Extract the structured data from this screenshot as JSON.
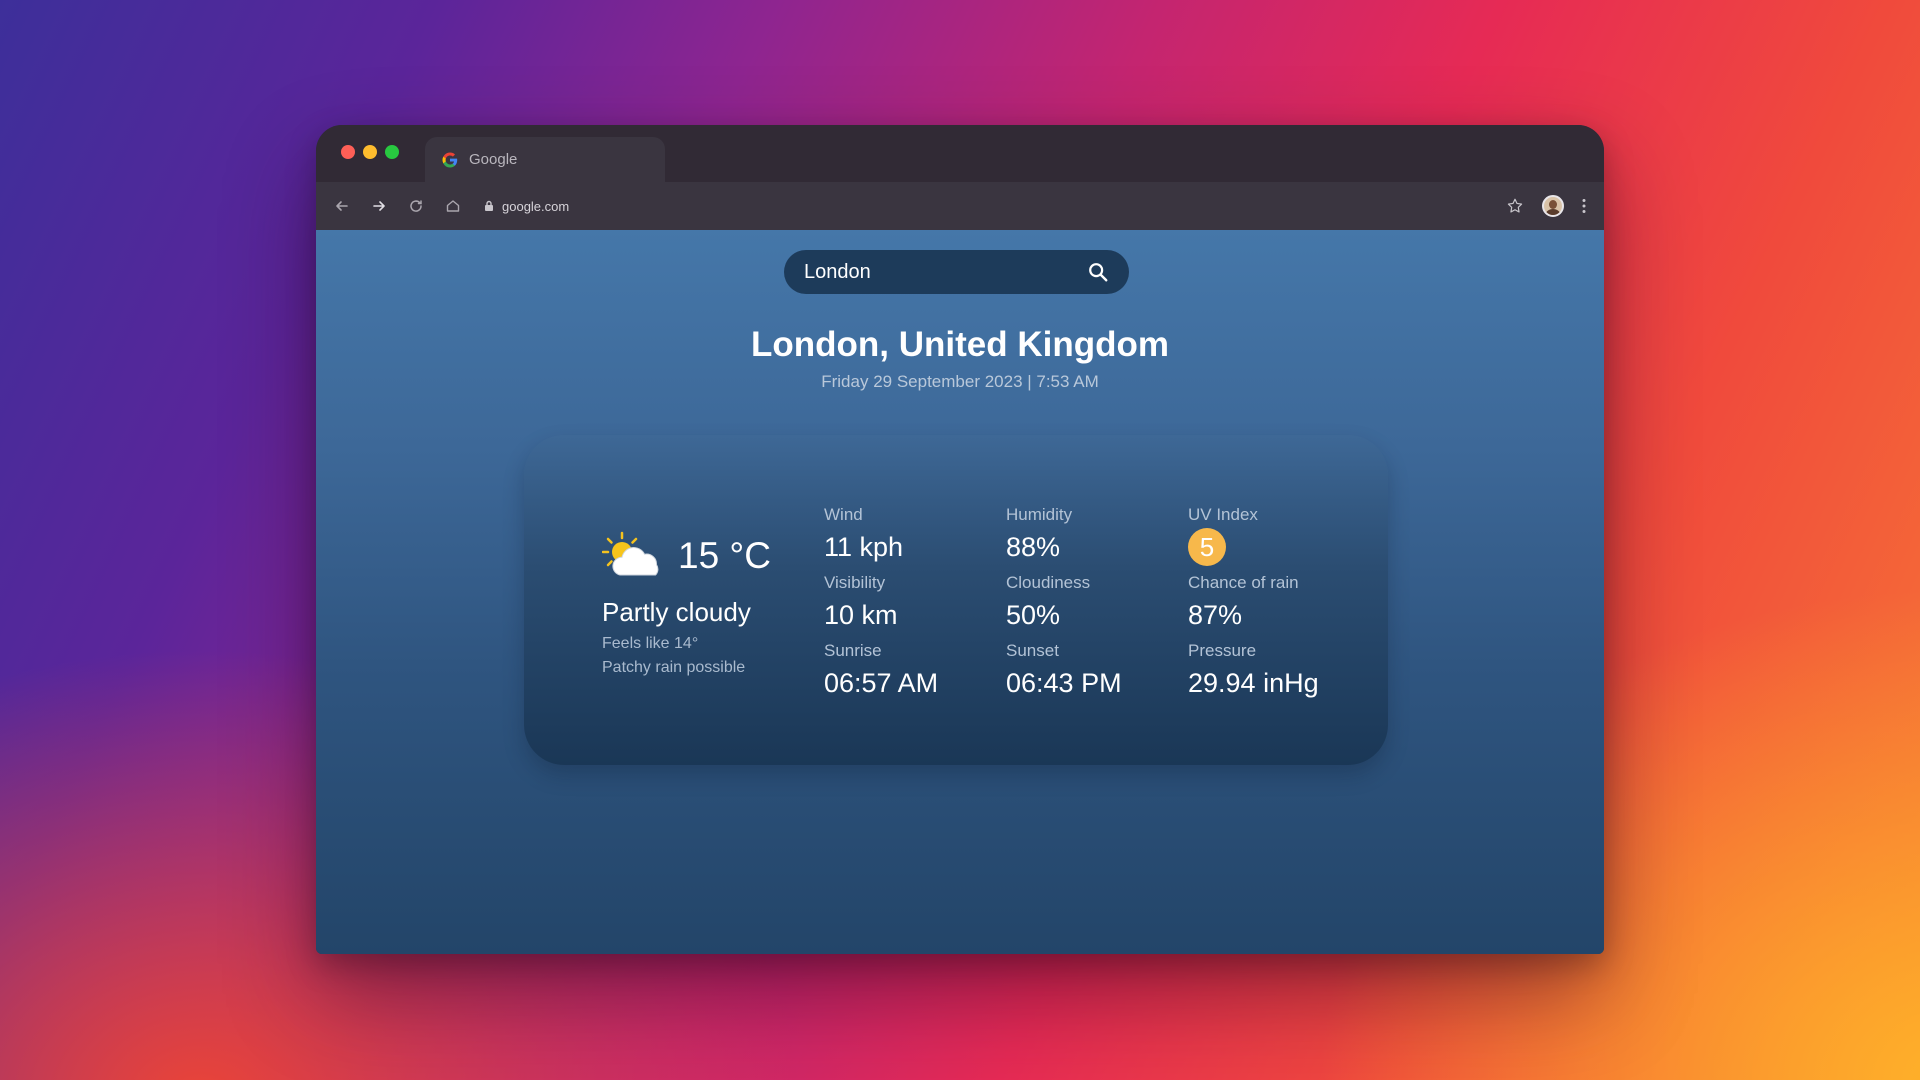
{
  "browser": {
    "tab_title": "Google",
    "url": "google.com"
  },
  "search": {
    "value": "London"
  },
  "location": {
    "name": "London, United Kingdom",
    "datetime": "Friday 29 September 2023 | 7:53 AM"
  },
  "current": {
    "icon": "partly-cloudy-icon",
    "temperature": "15 °C",
    "condition": "Partly cloudy",
    "feels_like": "Feels like 14°",
    "summary": "Patchy rain possible"
  },
  "stats": {
    "wind": {
      "label": "Wind",
      "value": "11 kph"
    },
    "humidity": {
      "label": "Humidity",
      "value": "88%"
    },
    "uv": {
      "label": "UV Index",
      "value": "5"
    },
    "visibility": {
      "label": "Visibility",
      "value": "10 km"
    },
    "cloudiness": {
      "label": "Cloudiness",
      "value": "50%"
    },
    "rain": {
      "label": "Chance of rain",
      "value": "87%"
    },
    "sunrise": {
      "label": "Sunrise",
      "value": "06:57 AM"
    },
    "sunset": {
      "label": "Sunset",
      "value": "06:43 PM"
    },
    "pressure": {
      "label": "Pressure",
      "value": "29.94 inHg"
    }
  },
  "colors": {
    "uv_badge": "#f7b84b",
    "search_bg": "#1d3b5a"
  }
}
